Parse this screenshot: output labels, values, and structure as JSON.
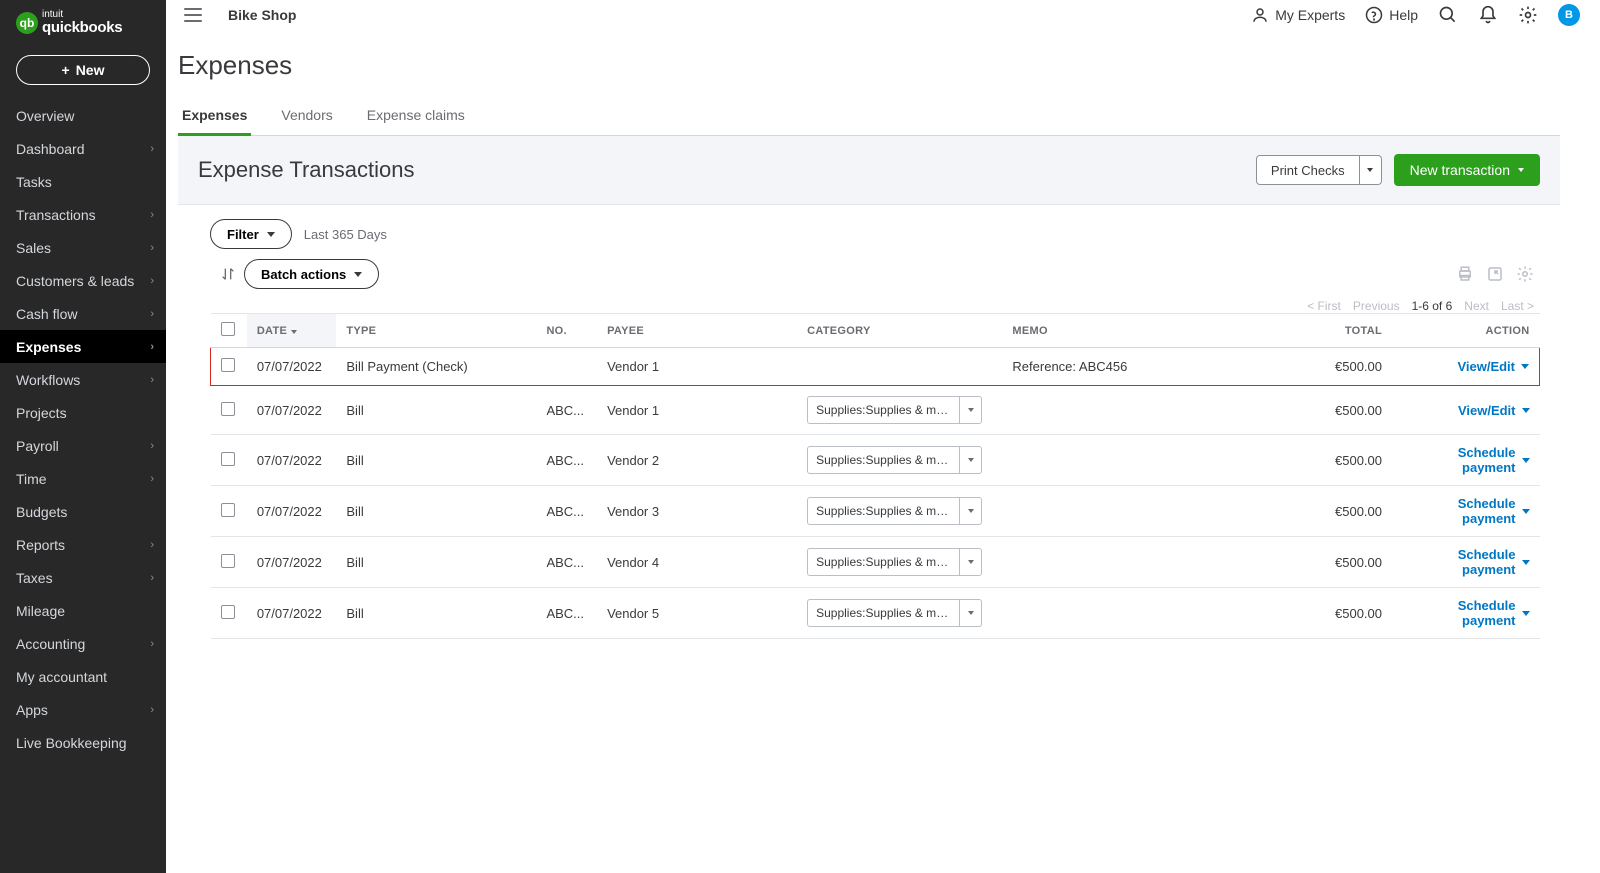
{
  "brand": {
    "intuit": "intuit",
    "product": "quickbooks"
  },
  "new_button": "New",
  "company": "Bike Shop",
  "topbar": {
    "experts": "My Experts",
    "help": "Help",
    "avatar": "B"
  },
  "sidebar": [
    {
      "label": "Overview",
      "chev": false
    },
    {
      "label": "Dashboard",
      "chev": true
    },
    {
      "label": "Tasks",
      "chev": false
    },
    {
      "label": "Transactions",
      "chev": true
    },
    {
      "label": "Sales",
      "chev": true
    },
    {
      "label": "Customers & leads",
      "chev": true
    },
    {
      "label": "Cash flow",
      "chev": true
    },
    {
      "label": "Expenses",
      "chev": true,
      "active": true
    },
    {
      "label": "Workflows",
      "chev": true
    },
    {
      "label": "Projects",
      "chev": false
    },
    {
      "label": "Payroll",
      "chev": true
    },
    {
      "label": "Time",
      "chev": true
    },
    {
      "label": "Budgets",
      "chev": false
    },
    {
      "label": "Reports",
      "chev": true
    },
    {
      "label": "Taxes",
      "chev": true
    },
    {
      "label": "Mileage",
      "chev": false
    },
    {
      "label": "Accounting",
      "chev": true
    },
    {
      "label": "My accountant",
      "chev": false
    },
    {
      "label": "Apps",
      "chev": true
    },
    {
      "label": "Live Bookkeeping",
      "chev": false
    }
  ],
  "page_title": "Expenses",
  "tabs": [
    {
      "label": "Expenses",
      "active": true
    },
    {
      "label": "Vendors"
    },
    {
      "label": "Expense claims"
    }
  ],
  "subheader_title": "Expense Transactions",
  "print_checks": "Print Checks",
  "new_transaction": "New transaction",
  "filter": "Filter",
  "filter_range": "Last 365 Days",
  "batch": "Batch actions",
  "pager": {
    "first": "< First",
    "prev": "Previous",
    "range": "1-6 of 6",
    "next": "Next",
    "last": "Last >"
  },
  "columns": {
    "date": "DATE",
    "type": "TYPE",
    "no": "NO.",
    "payee": "PAYEE",
    "category": "CATEGORY",
    "memo": "MEMO",
    "total": "TOTAL",
    "action": "ACTION"
  },
  "rows": [
    {
      "date": "07/07/2022",
      "type": "Bill Payment (Check)",
      "no": "",
      "payee": "Vendor 1",
      "category": "",
      "memo": "Reference: ABC456",
      "total": "€500.00",
      "action": "View/Edit",
      "highlight": true
    },
    {
      "date": "07/07/2022",
      "type": "Bill",
      "no": "ABC...",
      "payee": "Vendor 1",
      "category": "Supplies:Supplies & materials",
      "memo": "",
      "total": "€500.00",
      "action": "View/Edit"
    },
    {
      "date": "07/07/2022",
      "type": "Bill",
      "no": "ABC...",
      "payee": "Vendor 2",
      "category": "Supplies:Supplies & materials",
      "memo": "",
      "total": "€500.00",
      "action": "Schedule payment"
    },
    {
      "date": "07/07/2022",
      "type": "Bill",
      "no": "ABC...",
      "payee": "Vendor 3",
      "category": "Supplies:Supplies & materials",
      "memo": "",
      "total": "€500.00",
      "action": "Schedule payment"
    },
    {
      "date": "07/07/2022",
      "type": "Bill",
      "no": "ABC...",
      "payee": "Vendor 4",
      "category": "Supplies:Supplies & materials",
      "memo": "",
      "total": "€500.00",
      "action": "Schedule payment"
    },
    {
      "date": "07/07/2022",
      "type": "Bill",
      "no": "ABC...",
      "payee": "Vendor 5",
      "category": "Supplies:Supplies & materials",
      "memo": "",
      "total": "€500.00",
      "action": "Schedule payment"
    }
  ]
}
